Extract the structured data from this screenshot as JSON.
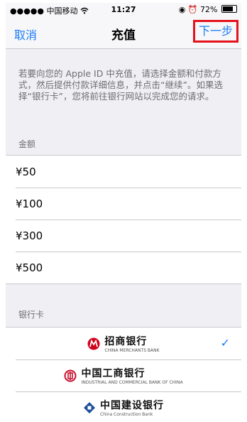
{
  "status_bar": {
    "signal": "●●●●● 中国移动",
    "time": "11:27",
    "battery_text": "72%"
  },
  "nav": {
    "cancel": "取消",
    "title": "充值",
    "next": "下一步"
  },
  "description": "若要向您的 Apple ID 中充值，请选择金额和付款方式，然后提供付款详细信息，并点击“继续”。如果选择“银行卡”，您将前往银行网站以完成您的请求。",
  "amount_section": {
    "header": "金额",
    "options": [
      "¥50",
      "¥100",
      "¥300",
      "¥500"
    ]
  },
  "bank_section": {
    "header": "银行卡",
    "banks": [
      {
        "name": "招商银行",
        "sub": "CHINA MERCHANTS BANK",
        "color": "#d0021b",
        "selected": true
      },
      {
        "name": "中国工商银行",
        "sub": "INDUSTRIAL AND COMMERCIAL BANK OF CHINA",
        "color": "#c8102e",
        "selected": false
      },
      {
        "name": "中国建设银行",
        "sub": "China Construction Bank",
        "color": "#1f4e9a",
        "selected": false
      }
    ]
  },
  "colors": {
    "accent": "#1a7cf5",
    "highlight_border": "#e3121b"
  }
}
